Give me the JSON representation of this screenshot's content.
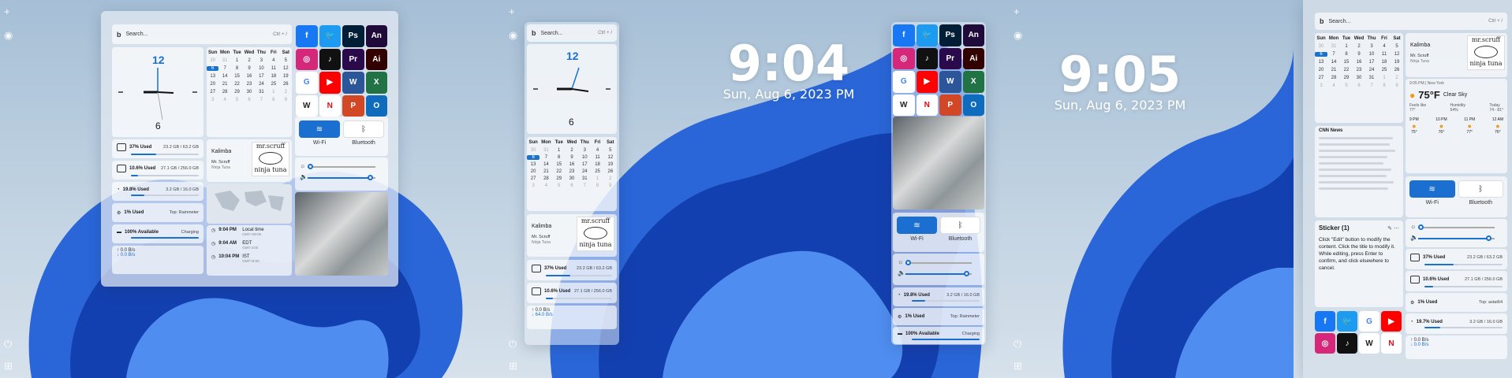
{
  "colors": {
    "accent": "#1a6fd1",
    "bloom": "#1f5fd8"
  },
  "common": {
    "search_placeholder": "Search...",
    "search_shortcut": "Ctrl + /",
    "wifi_label": "Wi-Fi",
    "bluetooth_label": "Bluetooth",
    "track_title": "Kalimba",
    "track_artist": "Mr. Scruff",
    "track_album": "Ninja Tuna",
    "album_art_text": "mr.scruff",
    "album_art_sub": "ninja tuna",
    "cpu_label": "1% Used",
    "cpu_top": "Top: Rainmeter",
    "battery_label": "100% Available",
    "battery_state": "Charging",
    "net_up": "0.0 B/s",
    "net_down": "0.0 B/s",
    "net_down_alt": "64.0 B/s",
    "ram_label": "37% Used",
    "ram_val": "23.2 GB / 63.2 GB",
    "disk1_label": "10.6% Used",
    "disk1_val": "27.1 GB / 256.0 GB",
    "disk2_label": "19.8% Used",
    "disk2_val": "3.2 GB / 16.0 GB",
    "disk3_label": "19.7% Used",
    "disk3_val": "3.2 GB / 16.0 GB",
    "cpu_top_alt": "Top: astat64"
  },
  "clock": {
    "top": "12",
    "bottom": "6"
  },
  "calendar": {
    "days": [
      "Sun",
      "Mon",
      "Tue",
      "Wed",
      "Thu",
      "Fri",
      "Sat"
    ],
    "rows": [
      [
        "30",
        "31",
        "1",
        "2",
        "3",
        "4",
        "5"
      ],
      [
        "6",
        "7",
        "8",
        "9",
        "10",
        "11",
        "12"
      ],
      [
        "13",
        "14",
        "15",
        "16",
        "17",
        "18",
        "19"
      ],
      [
        "20",
        "21",
        "22",
        "23",
        "24",
        "25",
        "26"
      ],
      [
        "27",
        "28",
        "29",
        "30",
        "31",
        "1",
        "2"
      ],
      [
        "3",
        "4",
        "5",
        "6",
        "7",
        "8",
        "9"
      ]
    ]
  },
  "timezones": [
    {
      "time": "9:04 PM",
      "name": "Local time",
      "sub": "GMT+08:00"
    },
    {
      "time": "9:04 AM",
      "name": "EDT",
      "sub": "GMT-4:00"
    },
    {
      "time": "10:04 PM",
      "name": "IST",
      "sub": "GMT+8:00"
    }
  ],
  "lock1": {
    "time": "9:04",
    "date": "Sun, Aug 6, 2023 PM"
  },
  "lock2": {
    "time": "9:05",
    "date": "Sun, Aug 6, 2023 PM"
  },
  "weather": {
    "loc": "9:05 PM | New York",
    "temp": "75°F",
    "cond": "Clear Sky",
    "feels": "Feels like",
    "feels_v": "77°",
    "hum": "Humidity",
    "hum_v": "54%",
    "today": "Today",
    "today_v": "74 - 81°",
    "hours": [
      "9 PM",
      "10 PM",
      "11 PM",
      "12 AM"
    ],
    "temps": [
      "75°",
      "76°",
      "77°",
      "76°"
    ]
  },
  "news": {
    "title": "CNN News"
  },
  "sticker": {
    "title": "Sticker (1)",
    "body": "Click \"Edit\" button to modify the content. Click the title to modify it. While editing, press Enter to confirm, and click elsewhere to cancel."
  },
  "apps": [
    {
      "n": "facebook",
      "t": "f",
      "c": "#1877f2"
    },
    {
      "n": "twitter",
      "t": "🐦",
      "c": "#1d9bf0"
    },
    {
      "n": "photoshop",
      "t": "Ps",
      "c": "#001e36"
    },
    {
      "n": "animate",
      "t": "An",
      "c": "#1f0a3a"
    },
    {
      "n": "instagram",
      "t": "◎",
      "c": "#d6287a"
    },
    {
      "n": "tiktok",
      "t": "♪",
      "c": "#111"
    },
    {
      "n": "premiere",
      "t": "Pr",
      "c": "#2a0a4a"
    },
    {
      "n": "illustrator",
      "t": "Ai",
      "c": "#330000"
    },
    {
      "n": "google",
      "t": "G",
      "c": "#ffffff"
    },
    {
      "n": "youtube",
      "t": "▶",
      "c": "#ff0000"
    },
    {
      "n": "word",
      "t": "W",
      "c": "#2b579a"
    },
    {
      "n": "excel",
      "t": "X",
      "c": "#217346"
    },
    {
      "n": "wikipedia",
      "t": "W",
      "c": "#ffffff"
    },
    {
      "n": "netflix",
      "t": "N",
      "c": "#ffffff"
    },
    {
      "n": "powerpoint",
      "t": "P",
      "c": "#d24726"
    },
    {
      "n": "outlook",
      "t": "O",
      "c": "#0f6cbd"
    }
  ]
}
